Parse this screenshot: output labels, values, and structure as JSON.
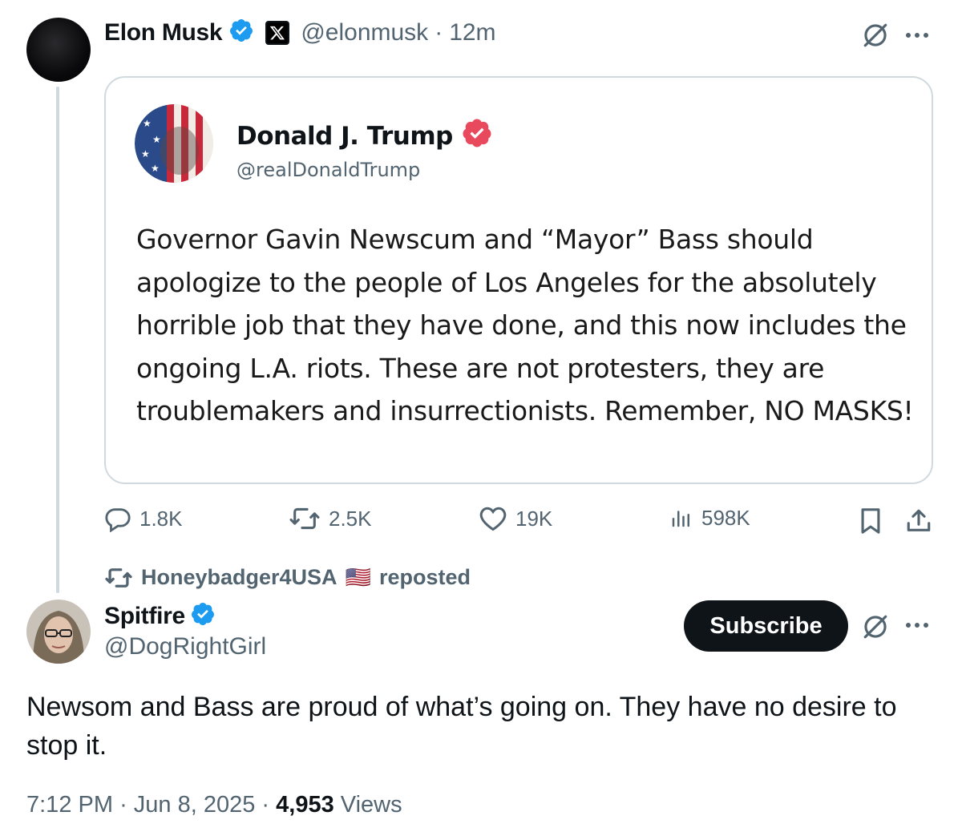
{
  "thread_post": {
    "author_name": "Elon Musk",
    "author_handle": "@elonmusk",
    "separator": "·",
    "time_ago": "12m"
  },
  "quote": {
    "author_name": "Donald J. Trump",
    "author_handle": "@realDonaldTrump",
    "text": "Governor Gavin Newscum and “Mayor” Bass should apologize to the people of Los Angeles for the absolutely horrible job that they have done, and this now includes the ongoing L.A. riots. These are not protesters, they are troublemakers and insurrectionists. Remember, NO MASKS!"
  },
  "actions": {
    "replies": "1.8K",
    "reposts": "2.5K",
    "likes": "19K",
    "views": "598K"
  },
  "repost_banner": {
    "user": "Honeybadger4USA",
    "flag": "🇺🇸",
    "suffix": "reposted"
  },
  "main_post": {
    "author_name": "Spitfire",
    "author_handle": "@DogRightGirl",
    "subscribe_label": "Subscribe",
    "text": "Newsom and Bass are proud of what’s going on. They have no desire to stop it.",
    "time": "7:12 PM",
    "date": "Jun 8, 2025",
    "views_count": "4,953",
    "views_label": "Views"
  },
  "colors": {
    "verified_blue": "#1d9bf0",
    "truth_verified": "#e8495c",
    "secondary_text": "#536471",
    "border": "#cfd9de"
  }
}
